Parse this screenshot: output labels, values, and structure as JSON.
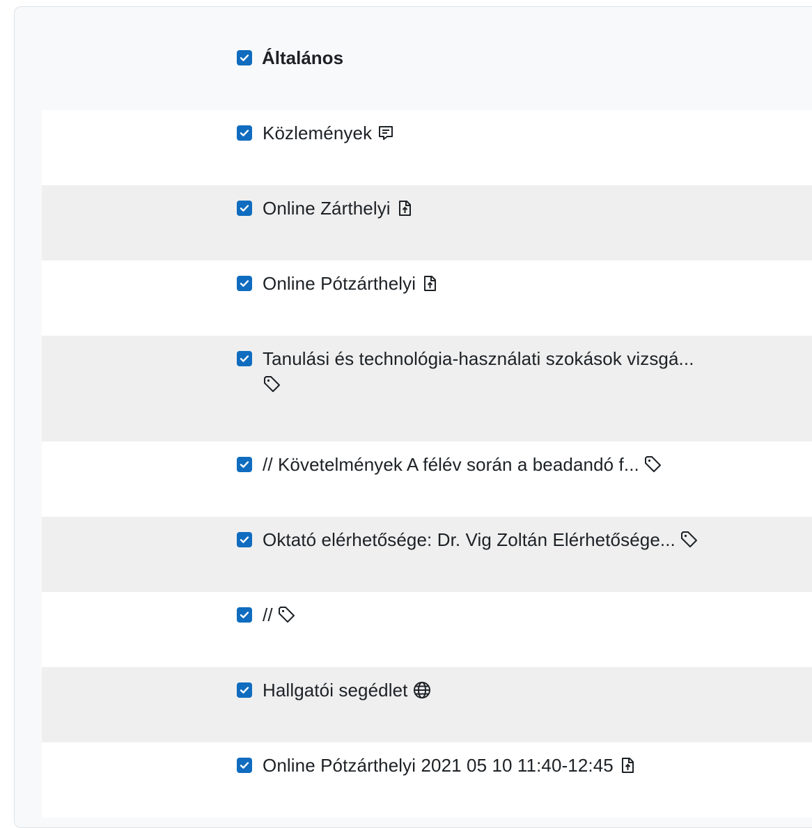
{
  "section": {
    "title": "Általános",
    "checked": true
  },
  "activities": [
    {
      "label": "Közlemények",
      "icon": "forum-icon",
      "checked": true
    },
    {
      "label": "Online Zárthelyi",
      "icon": "assignment-upload-icon",
      "checked": true
    },
    {
      "label": "Online Pótzárthelyi",
      "icon": "assignment-upload-icon",
      "checked": true
    },
    {
      "label": "Tanulási és technológia-használati szokások vizsgá...",
      "icon": "label-tag-icon",
      "checked": true
    },
    {
      "label": "// Követelmények A félév során a beadandó f...",
      "icon": "label-tag-icon",
      "checked": true
    },
    {
      "label": "Oktató elérhetősége: Dr. Vig Zoltán Elérhetősége...",
      "icon": "label-tag-icon",
      "checked": true
    },
    {
      "label": "//",
      "icon": "label-tag-icon",
      "checked": true
    },
    {
      "label": "Hallgatói segédlet",
      "icon": "url-globe-icon",
      "checked": true
    },
    {
      "label": "Online Pótzárthelyi 2021 05 10 11:40-12:45",
      "icon": "assignment-upload-icon",
      "checked": true
    }
  ],
  "colors": {
    "checkbox": "#0f6cbf",
    "row_alt": "#efefef",
    "panel_bg": "#f8f9fa"
  }
}
